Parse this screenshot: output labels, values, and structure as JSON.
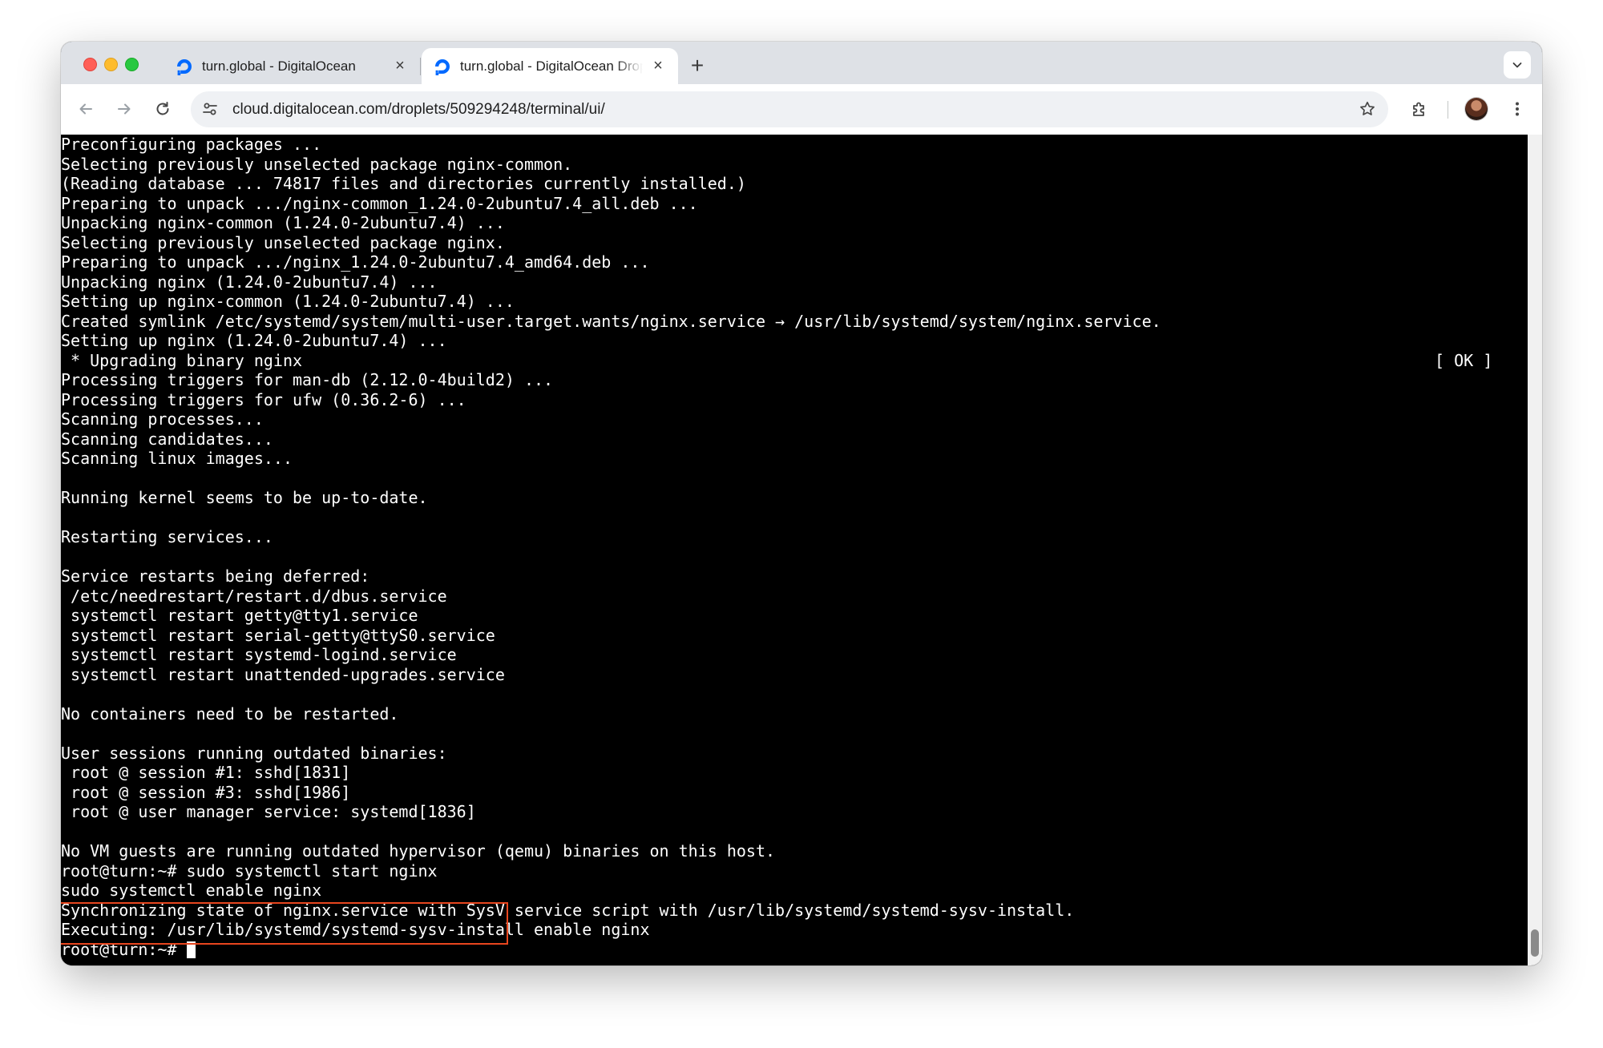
{
  "browser": {
    "tabs": [
      {
        "title": "turn.global - DigitalOcean",
        "active": false
      },
      {
        "title": "turn.global - DigitalOcean Droplets",
        "active": true
      }
    ],
    "url": "cloud.digitalocean.com/droplets/509294248/terminal/ui/",
    "colors": {
      "tabstrip": "#dee1e6",
      "omnibox": "#eff1f4",
      "favicon": "#0069ff",
      "highlight": "#e8461e"
    }
  },
  "terminal": {
    "lines": [
      "Preconfiguring packages ...",
      "Selecting previously unselected package nginx-common.",
      "(Reading database ... 74817 files and directories currently installed.)",
      "Preparing to unpack .../nginx-common_1.24.0-2ubuntu7.4_all.deb ...",
      "Unpacking nginx-common (1.24.0-2ubuntu7.4) ...",
      "Selecting previously unselected package nginx.",
      "Preparing to unpack .../nginx_1.24.0-2ubuntu7.4_amd64.deb ...",
      "Unpacking nginx (1.24.0-2ubuntu7.4) ...",
      "Setting up nginx-common (1.24.0-2ubuntu7.4) ...",
      "Created symlink /etc/systemd/system/multi-user.target.wants/nginx.service → /usr/lib/systemd/system/nginx.service.",
      "Setting up nginx (1.24.0-2ubuntu7.4) ...",
      " * Upgrading binary nginx",
      "Processing triggers for man-db (2.12.0-4build2) ...",
      "Processing triggers for ufw (0.36.2-6) ...",
      "Scanning processes...",
      "Scanning candidates...",
      "Scanning linux images...",
      "",
      "Running kernel seems to be up-to-date.",
      "",
      "Restarting services...",
      "",
      "Service restarts being deferred:",
      " /etc/needrestart/restart.d/dbus.service",
      " systemctl restart getty@tty1.service",
      " systemctl restart serial-getty@ttyS0.service",
      " systemctl restart systemd-logind.service",
      " systemctl restart unattended-upgrades.service",
      "",
      "No containers need to be restarted.",
      "",
      "User sessions running outdated binaries:",
      " root @ session #1: sshd[1831]",
      " root @ session #3: sshd[1986]",
      " root @ user manager service: systemd[1836]",
      "",
      "No VM guests are running outdated hypervisor (qemu) binaries on this host.",
      "root@turn:~# sudo systemctl start nginx",
      "sudo systemctl enable nginx",
      "Synchronizing state of nginx.service with SysV service script with /usr/lib/systemd/systemd-sysv-install.",
      "Executing: /usr/lib/systemd/systemd-sysv-install enable nginx"
    ],
    "ok_status": "[ OK ]",
    "prompt": "root@turn:~# ",
    "highlighted_line_indices": [
      37,
      38
    ]
  }
}
